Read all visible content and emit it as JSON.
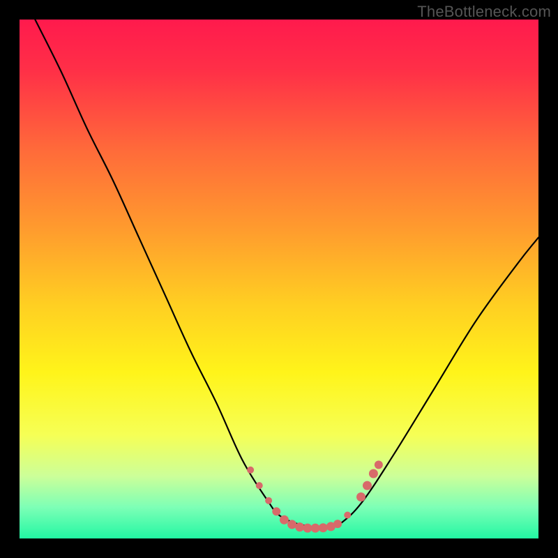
{
  "watermark": "TheBottleneck.com",
  "gradient": {
    "stops": [
      {
        "offset": 0.0,
        "color": "#ff1a4d"
      },
      {
        "offset": 0.1,
        "color": "#ff3047"
      },
      {
        "offset": 0.25,
        "color": "#ff6a3a"
      },
      {
        "offset": 0.4,
        "color": "#ff9a2e"
      },
      {
        "offset": 0.55,
        "color": "#ffcf22"
      },
      {
        "offset": 0.68,
        "color": "#fff41a"
      },
      {
        "offset": 0.8,
        "color": "#f6ff55"
      },
      {
        "offset": 0.88,
        "color": "#ccff99"
      },
      {
        "offset": 0.94,
        "color": "#7dffb6"
      },
      {
        "offset": 1.0,
        "color": "#22f7a3"
      }
    ]
  },
  "chart_data": {
    "type": "line",
    "title": "",
    "xlabel": "",
    "ylabel": "",
    "xlim": [
      0,
      100
    ],
    "ylim": [
      0,
      100
    ],
    "series": [
      {
        "name": "bottleneck-curve",
        "x": [
          3,
          8,
          13,
          18,
          23,
          28,
          33,
          38,
          43,
          48,
          50,
          53,
          56,
          58,
          60,
          62,
          66,
          72,
          80,
          88,
          96,
          100
        ],
        "y": [
          100,
          90,
          79,
          69,
          58,
          47,
          36,
          26,
          15,
          7,
          4.5,
          3,
          2.3,
          2.1,
          2.3,
          3,
          7,
          16,
          29,
          42,
          53,
          58
        ]
      }
    ],
    "markers": {
      "name": "highlight-segment",
      "color": "#d86a6a",
      "points": [
        {
          "x": 44.5,
          "y": 13.2,
          "r": 5
        },
        {
          "x": 46.2,
          "y": 10.2,
          "r": 5
        },
        {
          "x": 48.0,
          "y": 7.3,
          "r": 5
        },
        {
          "x": 49.5,
          "y": 5.2,
          "r": 6
        },
        {
          "x": 51.0,
          "y": 3.6,
          "r": 6.5
        },
        {
          "x": 52.5,
          "y": 2.7,
          "r": 6.5
        },
        {
          "x": 54.0,
          "y": 2.2,
          "r": 6.5
        },
        {
          "x": 55.5,
          "y": 2.0,
          "r": 6.5
        },
        {
          "x": 57.0,
          "y": 2.0,
          "r": 6.5
        },
        {
          "x": 58.5,
          "y": 2.05,
          "r": 6.5
        },
        {
          "x": 60.0,
          "y": 2.3,
          "r": 6.5
        },
        {
          "x": 61.3,
          "y": 2.8,
          "r": 6
        },
        {
          "x": 63.2,
          "y": 4.5,
          "r": 5
        },
        {
          "x": 65.8,
          "y": 8.0,
          "r": 6.5
        },
        {
          "x": 67.0,
          "y": 10.2,
          "r": 6.5
        },
        {
          "x": 68.2,
          "y": 12.5,
          "r": 6.5
        },
        {
          "x": 69.2,
          "y": 14.2,
          "r": 6
        }
      ]
    }
  }
}
